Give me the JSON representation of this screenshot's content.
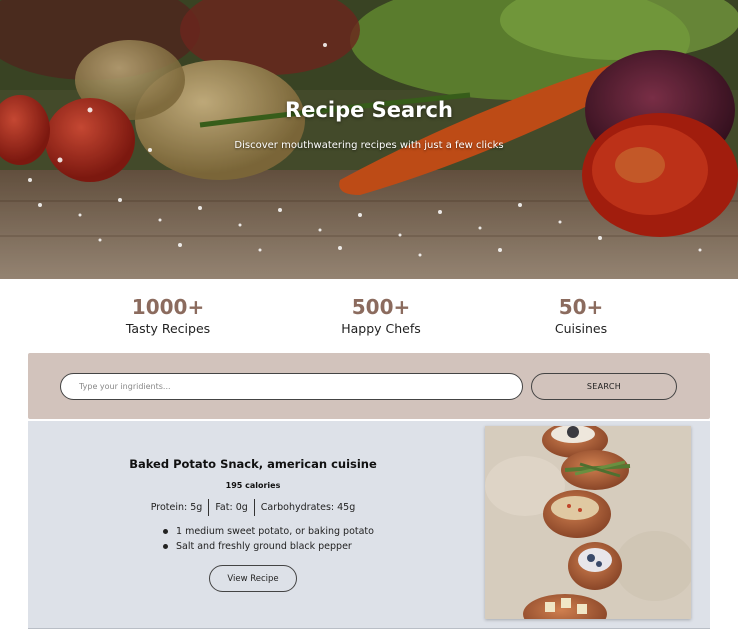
{
  "hero": {
    "title": "Recipe Search",
    "subtitle": "Discover mouthwatering recipes with just a few clicks"
  },
  "stats": [
    {
      "value": "1000+",
      "label": "Tasty Recipes"
    },
    {
      "value": "500+",
      "label": "Happy Chefs"
    },
    {
      "value": "50+",
      "label": "Cuisines"
    }
  ],
  "search": {
    "placeholder": "Type your ingridients...",
    "value": "",
    "button_label": "SEARCH"
  },
  "result": {
    "title": "Baked Potato Snack, american cuisine",
    "calories": "195 calories",
    "protein": "Protein: 5g",
    "fat": "Fat: 0g",
    "carbs": "Carbohydrates: 45g",
    "ingredients": [
      "1 medium sweet potato, or baking potato",
      "Salt and freshly ground black pepper"
    ],
    "view_label": "View Recipe"
  },
  "colors": {
    "accent": "#8b6b5e",
    "search_band": "#d2c3bc",
    "card_bg": "#dde1e8"
  }
}
